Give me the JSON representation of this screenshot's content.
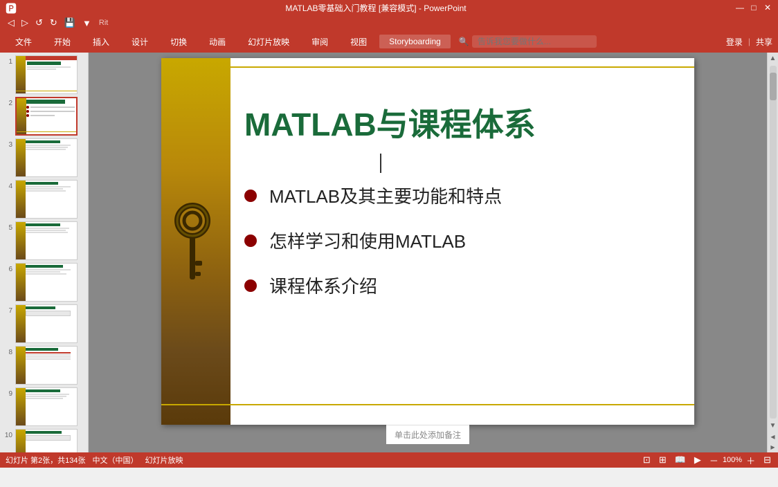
{
  "titlebar": {
    "title": "MATLAB零基础入门教程 [兼容模式] - PowerPoint",
    "controls": [
      "—",
      "□",
      "✕"
    ]
  },
  "quickaccess": {
    "buttons": [
      "⬅",
      "➡",
      "↺",
      "💾",
      "▼"
    ]
  },
  "menubar": {
    "items": [
      "文件",
      "开始",
      "插入",
      "设计",
      "切换",
      "动画",
      "幻灯片放映",
      "审阅",
      "视图",
      "Storyboarding"
    ]
  },
  "search": {
    "placeholder": "告诉我您要做什么..."
  },
  "auth": {
    "login": "登录",
    "share": "共享"
  },
  "slides": [
    {
      "num": "1",
      "type": "title_slide"
    },
    {
      "num": "2",
      "type": "content_slide",
      "active": true
    },
    {
      "num": "3",
      "type": "content_slide2"
    },
    {
      "num": "4",
      "type": "content_slide3"
    },
    {
      "num": "5",
      "type": "content_slide4"
    },
    {
      "num": "6",
      "type": "content_slide5"
    },
    {
      "num": "7",
      "type": "content_slide6"
    },
    {
      "num": "8",
      "type": "content_slide7"
    },
    {
      "num": "9",
      "type": "content_slide8"
    },
    {
      "num": "10",
      "type": "content_slide9"
    }
  ],
  "current_slide": {
    "title": "MATLAB与课程体系",
    "bullets": [
      "MATLAB及其主要功能和特点",
      "怎样学习和使用MATLAB",
      "课程体系介绍"
    ]
  },
  "notes": {
    "placeholder": "单击此处添加备注"
  },
  "statusbar": {
    "slide_info": "幻灯片 第2张，共134张",
    "mode": "中文（中国）",
    "presentation_mode": "幻灯片放映",
    "zoom": "100%",
    "fit_btn": "⊞"
  }
}
